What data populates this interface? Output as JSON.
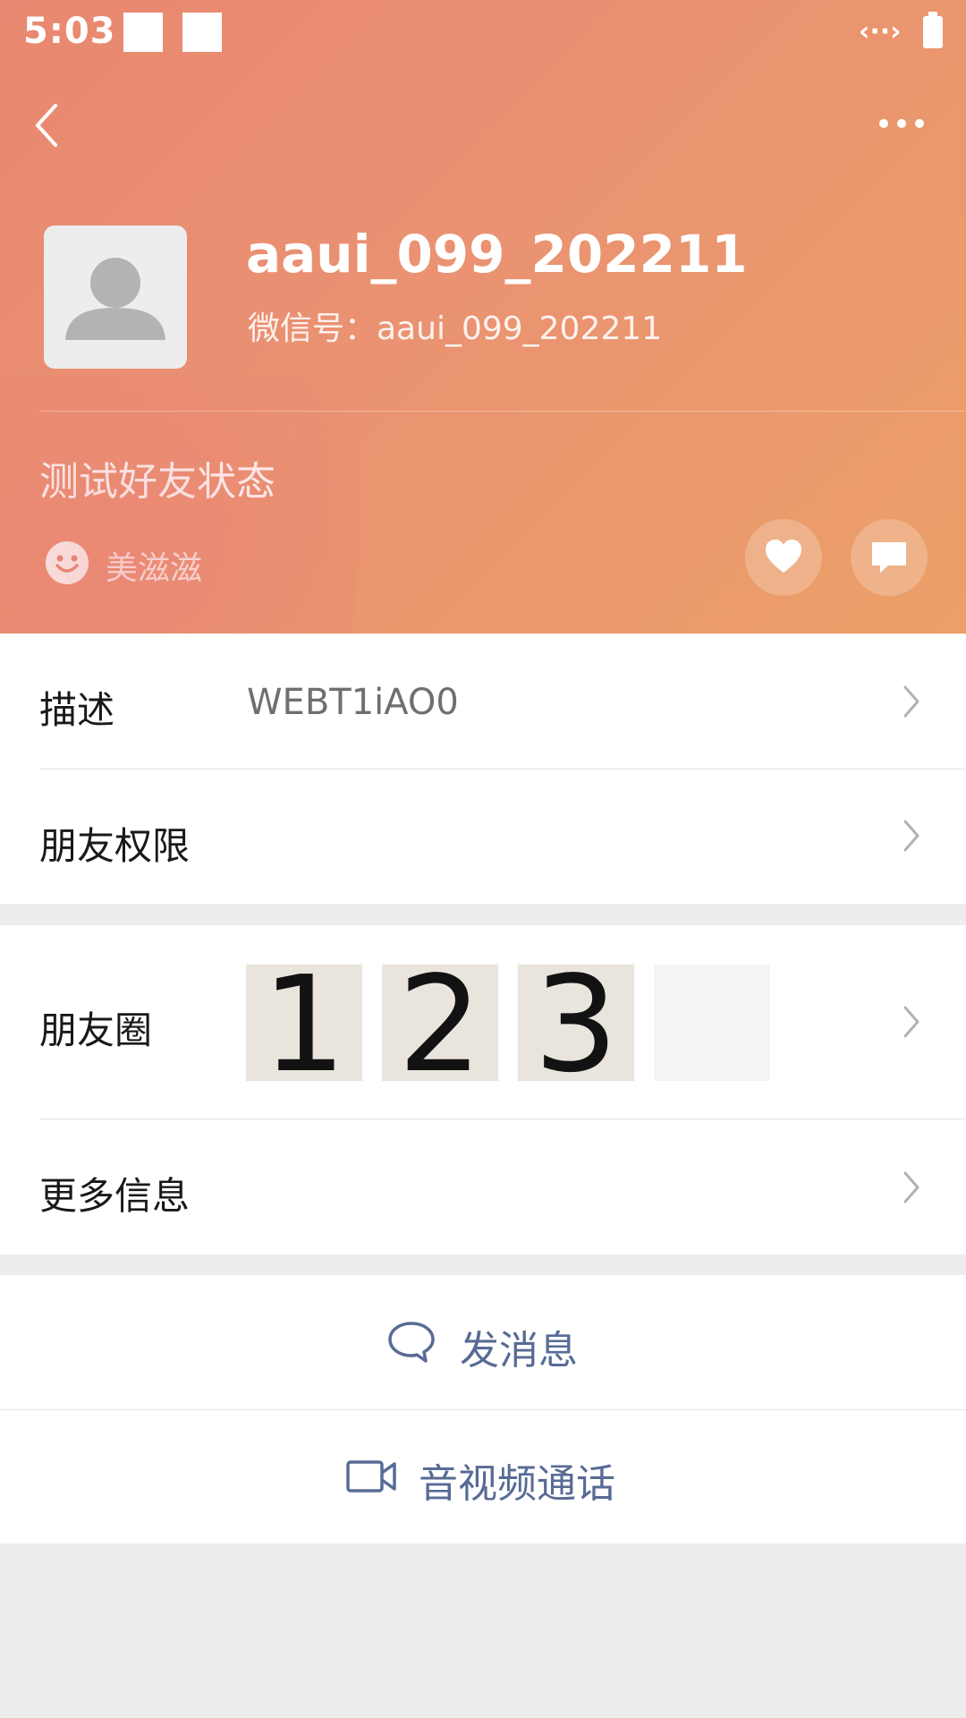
{
  "status_bar": {
    "time": "5:03"
  },
  "profile": {
    "name": "aaui_099_202211",
    "wechat_id": "微信号：aaui_099_202211",
    "status": "测试好友状态",
    "mood": "美滋滋"
  },
  "rows": {
    "description": {
      "label": "描述",
      "value": "WEBT1iAO0"
    },
    "permissions": {
      "label": "朋友权限"
    },
    "moments": {
      "label": "朋友圈",
      "thumbs": [
        "1",
        "2",
        "3",
        ""
      ]
    },
    "more_info": {
      "label": "更多信息"
    }
  },
  "actions": {
    "message": "发消息",
    "call": "音视频通话"
  },
  "colors": {
    "header_start": "#e98870",
    "header_end": "#eba067",
    "link": "#576b95",
    "background": "#ededed"
  },
  "icons": [
    "back-icon",
    "more-icon",
    "avatar-placeholder-icon",
    "smile-icon",
    "heart-icon",
    "comment-icon",
    "chevron-right-icon",
    "chat-bubble-icon",
    "video-camera-icon"
  ]
}
